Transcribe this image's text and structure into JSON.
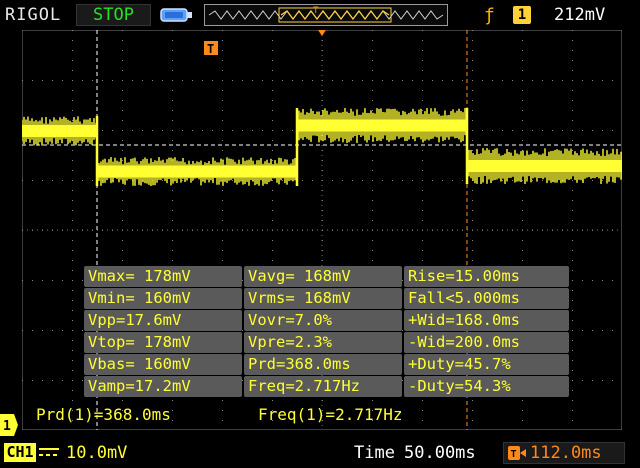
{
  "header": {
    "brand": "RIGOL",
    "run_status": "STOP",
    "trigger_source": "1",
    "trigger_level": "212mV",
    "trigger_marker": "T"
  },
  "measurements": {
    "rows": [
      [
        "Vmax= 178mV",
        "Vavg= 168mV",
        "Rise=15.00ms"
      ],
      [
        "Vmin= 160mV",
        "Vrms= 168mV",
        "Fall<5.000ms"
      ],
      [
        "Vpp=17.6mV",
        "Vovr=7.0%",
        "+Wid=168.0ms"
      ],
      [
        "Vtop= 178mV",
        "Vpre=2.3%",
        "-Wid=200.0ms"
      ],
      [
        "Vbas= 160mV",
        "Prd=368.0ms",
        "+Duty=45.7%"
      ],
      [
        "Vamp=17.2mV",
        "Freq=2.717Hz",
        "-Duty=54.3%"
      ]
    ]
  },
  "cursor_readout": {
    "period": "Prd(1)=368.0ms",
    "frequency": "Freq(1)=2.717Hz"
  },
  "footer": {
    "channel": "CH1",
    "channel_scale": "10.0mV",
    "time_label": "Time",
    "time_base": "50.00ms",
    "trigger_position": "112.0ms"
  },
  "colors": {
    "trace": "#ffff33",
    "trigger": "#ff8a1a",
    "run_status": "#25e025",
    "grid": "#808080"
  },
  "icons": {
    "usb": "usb-icon",
    "trigger_slope": "rising-edge-icon",
    "coupling": "dc-coupling-icon",
    "trigger_position": "trigger-position-icon"
  }
}
